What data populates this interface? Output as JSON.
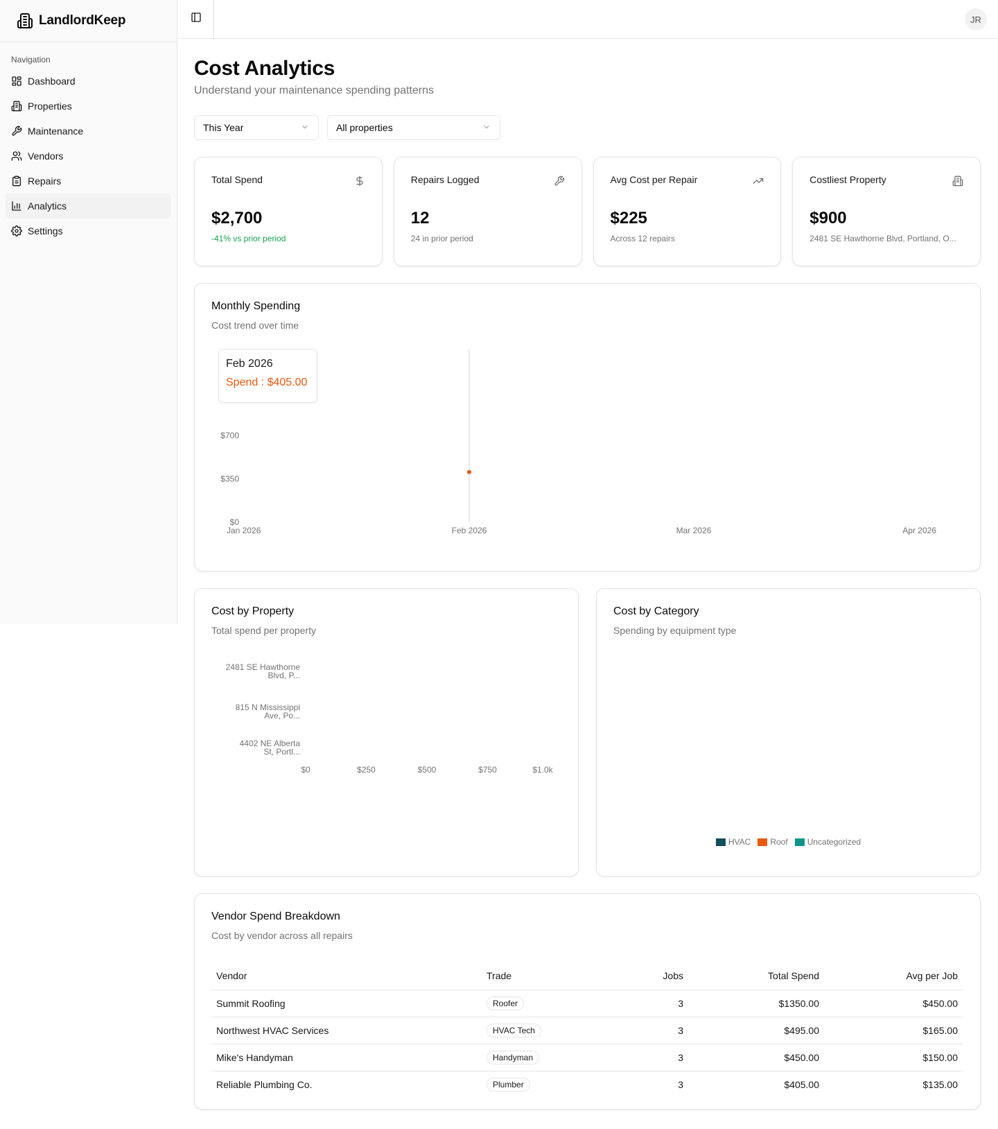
{
  "app": {
    "name": "LandlordKeep",
    "user_initials": "JR"
  },
  "sidebar": {
    "group_label": "Navigation",
    "items": [
      {
        "label": "Dashboard",
        "icon": "grid-icon"
      },
      {
        "label": "Properties",
        "icon": "building-icon"
      },
      {
        "label": "Maintenance",
        "icon": "wrench-icon"
      },
      {
        "label": "Vendors",
        "icon": "users-icon"
      },
      {
        "label": "Repairs",
        "icon": "clipboard-icon"
      },
      {
        "label": "Analytics",
        "icon": "bar-chart-icon",
        "active": true
      },
      {
        "label": "Settings",
        "icon": "gear-icon"
      }
    ]
  },
  "page": {
    "title": "Cost Analytics",
    "subtitle": "Understand your maintenance spending patterns"
  },
  "filters": {
    "period": "This Year",
    "property": "All properties"
  },
  "stats": [
    {
      "label": "Total Spend",
      "value": "$2,700",
      "sub": "-41% vs prior period",
      "icon": "dollar-icon"
    },
    {
      "label": "Repairs Logged",
      "value": "12",
      "sub": "24 in prior period",
      "icon": "wrench-icon"
    },
    {
      "label": "Avg Cost per Repair",
      "value": "$225",
      "sub": "Across 12 repairs",
      "icon": "trending-up-icon"
    },
    {
      "label": "Costliest Property",
      "value": "$900",
      "sub": "2481 SE Hawthorne Blvd, Portland, O...",
      "icon": "building-icon"
    }
  ],
  "monthly": {
    "title": "Monthly Spending",
    "subtitle": "Cost trend over time",
    "tooltip": {
      "label": "Feb 2026",
      "value": "Spend : $405.00"
    }
  },
  "cost_by_property": {
    "title": "Cost by Property",
    "subtitle": "Total spend per property"
  },
  "cost_by_category": {
    "title": "Cost by Category",
    "subtitle": "Spending by equipment type"
  },
  "vendor_table": {
    "title": "Vendor Spend Breakdown",
    "subtitle": "Cost by vendor across all repairs",
    "columns": [
      "Vendor",
      "Trade",
      "Jobs",
      "Total Spend",
      "Avg per Job"
    ],
    "rows": [
      {
        "vendor": "Summit Roofing",
        "trade": "Roofer",
        "jobs": "3",
        "total": "$1350.00",
        "avg": "$450.00"
      },
      {
        "vendor": "Northwest HVAC Services",
        "trade": "HVAC Tech",
        "jobs": "3",
        "total": "$495.00",
        "avg": "$165.00"
      },
      {
        "vendor": "Mike's Handyman",
        "trade": "Handyman",
        "jobs": "3",
        "total": "$450.00",
        "avg": "$150.00"
      },
      {
        "vendor": "Reliable Plumbing Co.",
        "trade": "Plumber",
        "jobs": "3",
        "total": "$405.00",
        "avg": "$135.00"
      }
    ]
  },
  "chart_data": [
    {
      "type": "line",
      "x": [
        "Jan 2026",
        "Feb 2026",
        "Mar 2026",
        "Apr 2026"
      ],
      "series": [
        {
          "values": [
            null,
            405,
            null,
            null
          ],
          "color": "#ea580c"
        }
      ],
      "y_ticks": [
        "$0",
        "$350",
        "$700"
      ],
      "ylim": [
        0,
        1400
      ],
      "active_index": 1
    },
    {
      "type": "bar",
      "orientation": "horizontal",
      "categories": [
        "2481 SE Hawthorne Blvd, P...",
        "815 N Mississippi Ave, Po...",
        "4402 NE Alberta St, Portl..."
      ],
      "values": [
        null,
        null,
        null
      ],
      "x_ticks": [
        "$0",
        "$250",
        "$500",
        "$750",
        "$1.0k"
      ],
      "xlim": [
        0,
        1000
      ]
    },
    {
      "type": "pie",
      "legend": [
        {
          "name": "HVAC",
          "color": "#134e5e"
        },
        {
          "name": "Roof",
          "color": "#ea580c"
        },
        {
          "name": "Uncategorized",
          "color": "#0d9488"
        }
      ],
      "legend_position": "bottom"
    }
  ]
}
